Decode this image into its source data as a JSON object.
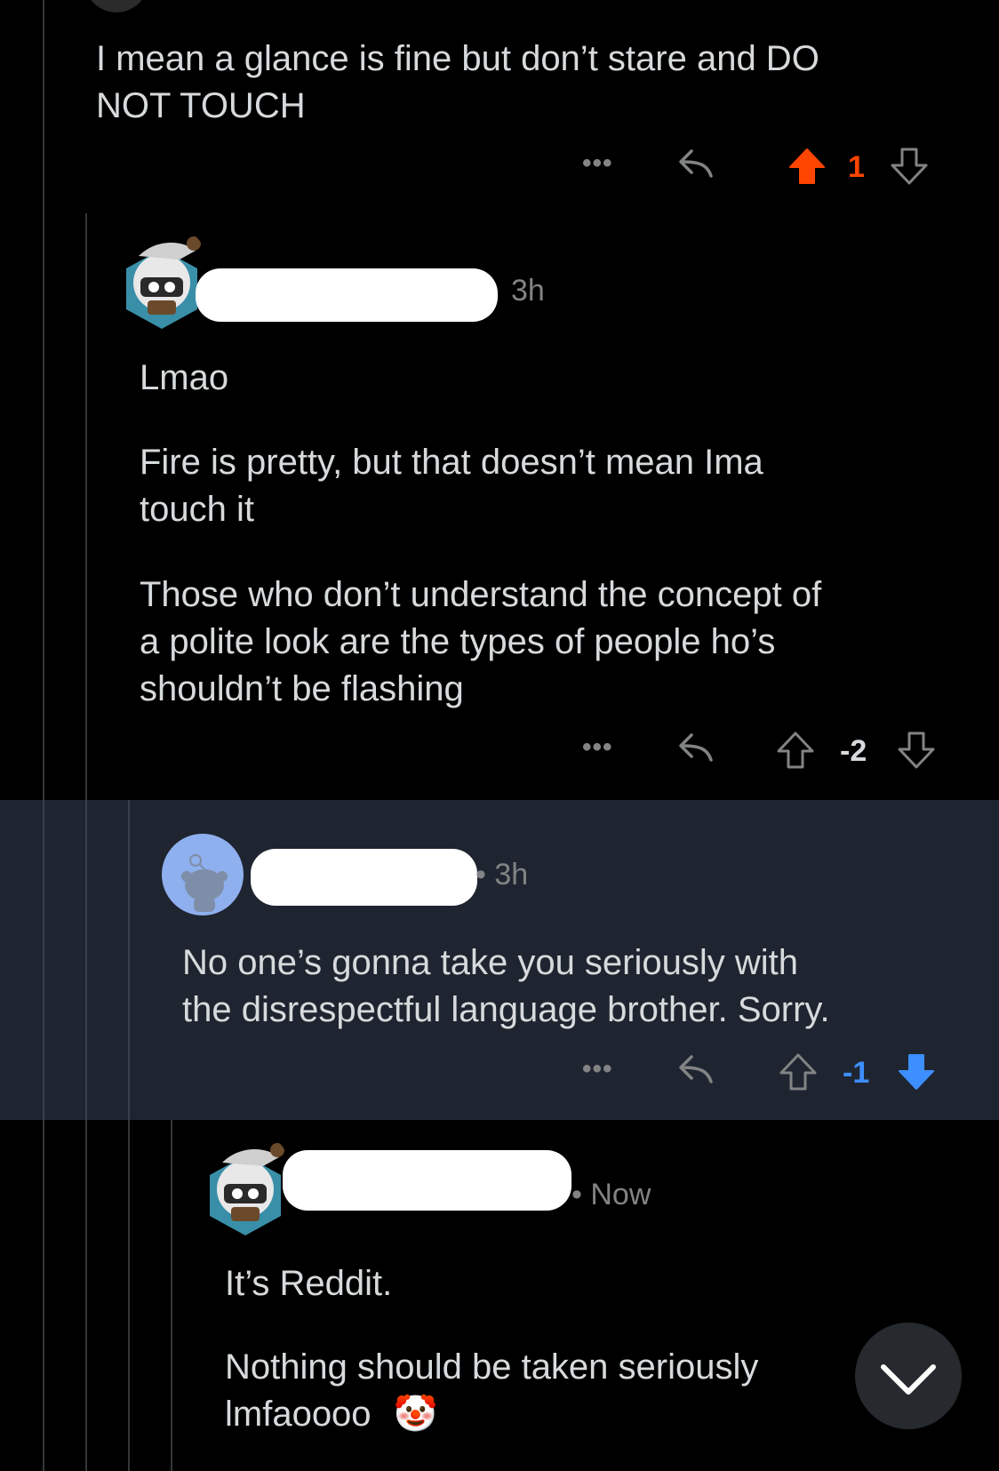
{
  "comments": [
    {
      "body": [
        "I mean a glance is fine but don’t stare and DO",
        "NOT TOUCH"
      ],
      "score": "1",
      "vote_state": "upvoted",
      "more_label": "•••"
    },
    {
      "time": "3h",
      "body": [
        "Lmao",
        "Fire is pretty, but that doesn’t mean Ima",
        "touch it",
        "Those who don’t understand the concept of",
        "a polite look are the types of people ho’s",
        "shouldn’t be flashing"
      ],
      "score": "-2",
      "vote_state": "none",
      "more_label": "•••"
    },
    {
      "time": "• 3h",
      "body": [
        "No one’s gonna take you seriously with",
        "the disrespectful language brother. Sorry."
      ],
      "score": "-1",
      "vote_state": "downvoted",
      "more_label": "•••"
    },
    {
      "time": "• Now",
      "body": [
        "It’s Reddit.",
        "Nothing should be taken seriously",
        "lmfaoooo"
      ],
      "emoji": "🤡"
    }
  ],
  "icons": {
    "reply": "reply-icon",
    "upvote": "upvote-arrow-icon",
    "downvote": "downvote-arrow-icon",
    "scroll": "chevron-down-icon"
  },
  "colors": {
    "upvote": "#ff4500",
    "downvote": "#3d8eff",
    "muted": "#818384",
    "highlight_bg": "#1f2530"
  }
}
